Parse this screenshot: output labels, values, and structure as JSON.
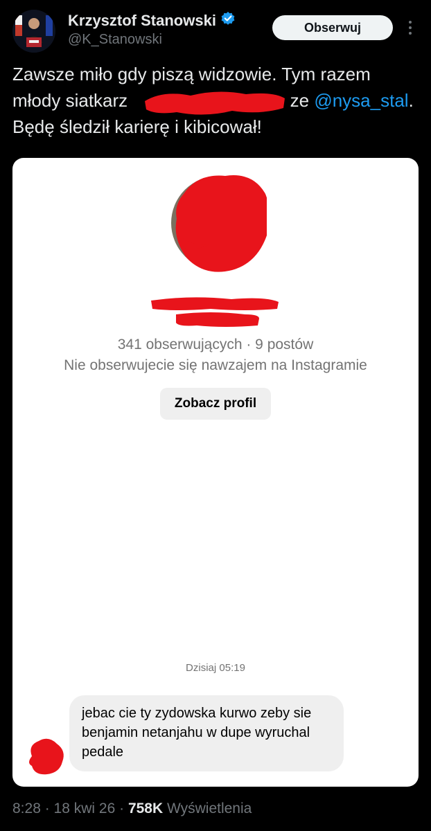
{
  "author": {
    "display_name": "Krzysztof Stanowski",
    "handle": "@K_Stanowski",
    "verified_icon": "verified-badge-icon",
    "follow_label": "Obserwuj"
  },
  "tweet": {
    "line1": "Zawsze miło gdy piszą widzowie. Tym razem",
    "line2_prefix": "młody siatkarz",
    "line2_suffix": "ze",
    "mention": "@nysa_stal",
    "line2_end": ".",
    "line3": "Będę śledził karierę i kibicował!"
  },
  "card": {
    "stats": "341 obserwujących · 9 postów",
    "mutual": "Nie obserwujecie się nawzajem na Instagramie",
    "view_profile_label": "Zobacz profil",
    "timestamp": "Dzisiaj 05:19",
    "message": "jebac cie ty zydowska kurwo zeby sie benjamin netanjahu w dupe wyruchal pedale"
  },
  "meta": {
    "time": "8:28",
    "date": "18 kwi 26",
    "views": "758K",
    "views_label": "Wyświetlenia"
  },
  "colors": {
    "background": "#000000",
    "text": "#e7e9ea",
    "secondary": "#71767b",
    "accent": "#1d9bf0",
    "redaction": "#e8141b"
  }
}
